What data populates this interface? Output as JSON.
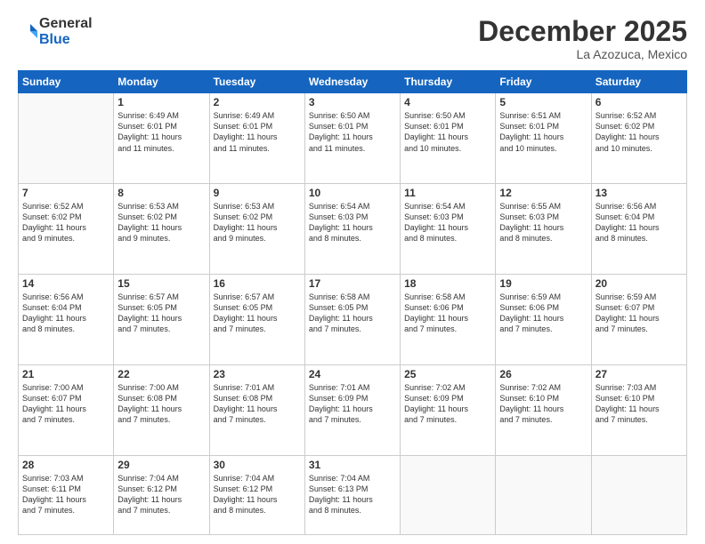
{
  "header": {
    "logo_line1": "General",
    "logo_line2": "Blue",
    "month": "December 2025",
    "location": "La Azozuca, Mexico"
  },
  "weekdays": [
    "Sunday",
    "Monday",
    "Tuesday",
    "Wednesday",
    "Thursday",
    "Friday",
    "Saturday"
  ],
  "weeks": [
    [
      {
        "day": "",
        "info": ""
      },
      {
        "day": "1",
        "info": "Sunrise: 6:49 AM\nSunset: 6:01 PM\nDaylight: 11 hours\nand 11 minutes."
      },
      {
        "day": "2",
        "info": "Sunrise: 6:49 AM\nSunset: 6:01 PM\nDaylight: 11 hours\nand 11 minutes."
      },
      {
        "day": "3",
        "info": "Sunrise: 6:50 AM\nSunset: 6:01 PM\nDaylight: 11 hours\nand 11 minutes."
      },
      {
        "day": "4",
        "info": "Sunrise: 6:50 AM\nSunset: 6:01 PM\nDaylight: 11 hours\nand 10 minutes."
      },
      {
        "day": "5",
        "info": "Sunrise: 6:51 AM\nSunset: 6:01 PM\nDaylight: 11 hours\nand 10 minutes."
      },
      {
        "day": "6",
        "info": "Sunrise: 6:52 AM\nSunset: 6:02 PM\nDaylight: 11 hours\nand 10 minutes."
      }
    ],
    [
      {
        "day": "7",
        "info": "Sunrise: 6:52 AM\nSunset: 6:02 PM\nDaylight: 11 hours\nand 9 minutes."
      },
      {
        "day": "8",
        "info": "Sunrise: 6:53 AM\nSunset: 6:02 PM\nDaylight: 11 hours\nand 9 minutes."
      },
      {
        "day": "9",
        "info": "Sunrise: 6:53 AM\nSunset: 6:02 PM\nDaylight: 11 hours\nand 9 minutes."
      },
      {
        "day": "10",
        "info": "Sunrise: 6:54 AM\nSunset: 6:03 PM\nDaylight: 11 hours\nand 8 minutes."
      },
      {
        "day": "11",
        "info": "Sunrise: 6:54 AM\nSunset: 6:03 PM\nDaylight: 11 hours\nand 8 minutes."
      },
      {
        "day": "12",
        "info": "Sunrise: 6:55 AM\nSunset: 6:03 PM\nDaylight: 11 hours\nand 8 minutes."
      },
      {
        "day": "13",
        "info": "Sunrise: 6:56 AM\nSunset: 6:04 PM\nDaylight: 11 hours\nand 8 minutes."
      }
    ],
    [
      {
        "day": "14",
        "info": "Sunrise: 6:56 AM\nSunset: 6:04 PM\nDaylight: 11 hours\nand 8 minutes."
      },
      {
        "day": "15",
        "info": "Sunrise: 6:57 AM\nSunset: 6:05 PM\nDaylight: 11 hours\nand 7 minutes."
      },
      {
        "day": "16",
        "info": "Sunrise: 6:57 AM\nSunset: 6:05 PM\nDaylight: 11 hours\nand 7 minutes."
      },
      {
        "day": "17",
        "info": "Sunrise: 6:58 AM\nSunset: 6:05 PM\nDaylight: 11 hours\nand 7 minutes."
      },
      {
        "day": "18",
        "info": "Sunrise: 6:58 AM\nSunset: 6:06 PM\nDaylight: 11 hours\nand 7 minutes."
      },
      {
        "day": "19",
        "info": "Sunrise: 6:59 AM\nSunset: 6:06 PM\nDaylight: 11 hours\nand 7 minutes."
      },
      {
        "day": "20",
        "info": "Sunrise: 6:59 AM\nSunset: 6:07 PM\nDaylight: 11 hours\nand 7 minutes."
      }
    ],
    [
      {
        "day": "21",
        "info": "Sunrise: 7:00 AM\nSunset: 6:07 PM\nDaylight: 11 hours\nand 7 minutes."
      },
      {
        "day": "22",
        "info": "Sunrise: 7:00 AM\nSunset: 6:08 PM\nDaylight: 11 hours\nand 7 minutes."
      },
      {
        "day": "23",
        "info": "Sunrise: 7:01 AM\nSunset: 6:08 PM\nDaylight: 11 hours\nand 7 minutes."
      },
      {
        "day": "24",
        "info": "Sunrise: 7:01 AM\nSunset: 6:09 PM\nDaylight: 11 hours\nand 7 minutes."
      },
      {
        "day": "25",
        "info": "Sunrise: 7:02 AM\nSunset: 6:09 PM\nDaylight: 11 hours\nand 7 minutes."
      },
      {
        "day": "26",
        "info": "Sunrise: 7:02 AM\nSunset: 6:10 PM\nDaylight: 11 hours\nand 7 minutes."
      },
      {
        "day": "27",
        "info": "Sunrise: 7:03 AM\nSunset: 6:10 PM\nDaylight: 11 hours\nand 7 minutes."
      }
    ],
    [
      {
        "day": "28",
        "info": "Sunrise: 7:03 AM\nSunset: 6:11 PM\nDaylight: 11 hours\nand 7 minutes."
      },
      {
        "day": "29",
        "info": "Sunrise: 7:04 AM\nSunset: 6:12 PM\nDaylight: 11 hours\nand 7 minutes."
      },
      {
        "day": "30",
        "info": "Sunrise: 7:04 AM\nSunset: 6:12 PM\nDaylight: 11 hours\nand 8 minutes."
      },
      {
        "day": "31",
        "info": "Sunrise: 7:04 AM\nSunset: 6:13 PM\nDaylight: 11 hours\nand 8 minutes."
      },
      {
        "day": "",
        "info": ""
      },
      {
        "day": "",
        "info": ""
      },
      {
        "day": "",
        "info": ""
      }
    ]
  ]
}
